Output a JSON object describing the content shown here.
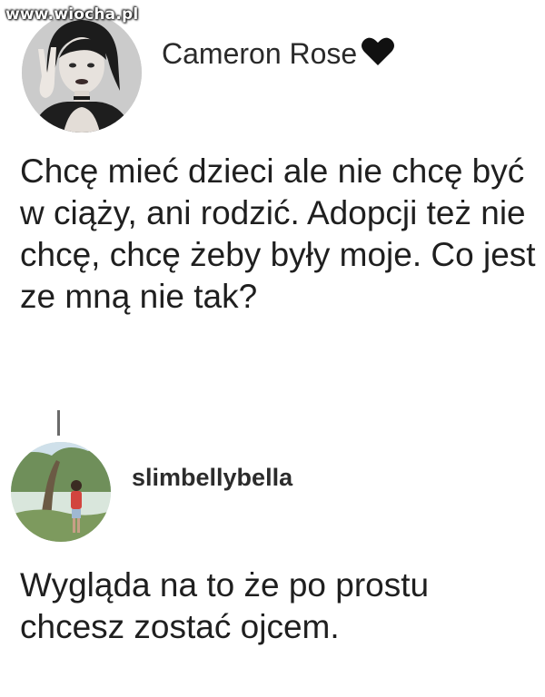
{
  "watermark": {
    "text": "www.wiocha.pl"
  },
  "post": {
    "author": "Cameron Rose",
    "author_emoji_icon": "black-heart-icon",
    "text": "Chcę mieć dzieci ale nie chcę być w ciąży, ani rodzić. Adopcji też nie chcę, chcę żeby były moje. Co jest ze mną nie tak?"
  },
  "reply": {
    "author": "slimbellybella",
    "text": "Wygląda na to że po prostu chcesz zostać ojcem."
  },
  "colors": {
    "background": "#ffffff",
    "text": "#1f1f1f",
    "heart": "#111111"
  }
}
